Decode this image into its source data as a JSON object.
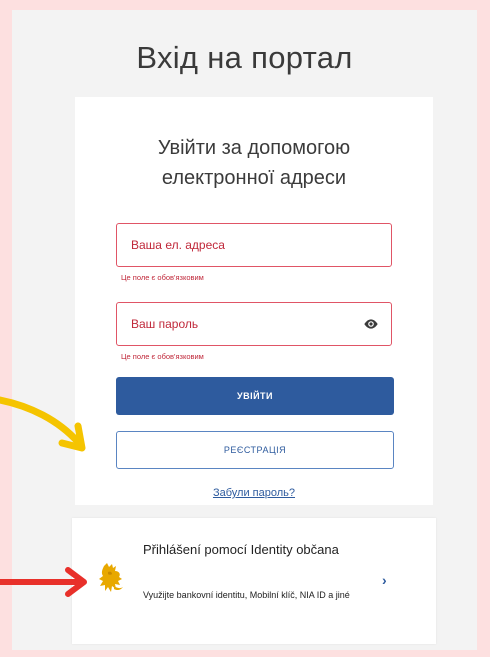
{
  "page": {
    "title": "Вхід на портал"
  },
  "login_card": {
    "subtitle_line1": "Увійти за допомогою",
    "subtitle_line2": "електронної адреси",
    "email_placeholder": "Ваша ел. адреса",
    "email_error": "Це поле є обов'язковим",
    "password_placeholder": "Ваш пароль",
    "password_error": "Це поле є обов'язковим",
    "password_toggle_icon": "eye-icon",
    "login_button": "УВІЙТИ",
    "register_button": "РЕЄСТРАЦІЯ",
    "forgot_link": "Забули пароль?"
  },
  "identity_card": {
    "title": "Přihlášení pomocí Identity občana",
    "description": "Využijte bankovní identitu, Mobilní klíč, NIA ID a jiné",
    "logo_icon": "czech-lion-icon",
    "chevron_icon": "chevron-right-icon"
  },
  "annotations": {
    "yellow_arrow_icon": "yellow-arrow-icon",
    "red_arrow_icon": "red-arrow-icon"
  },
  "colors": {
    "frame": "#fde0e0",
    "background": "#f3f3f3",
    "error": "#c0283a",
    "primary": "#2e5b9e",
    "yellow_arrow": "#f5c400",
    "red_arrow": "#e8302a"
  }
}
